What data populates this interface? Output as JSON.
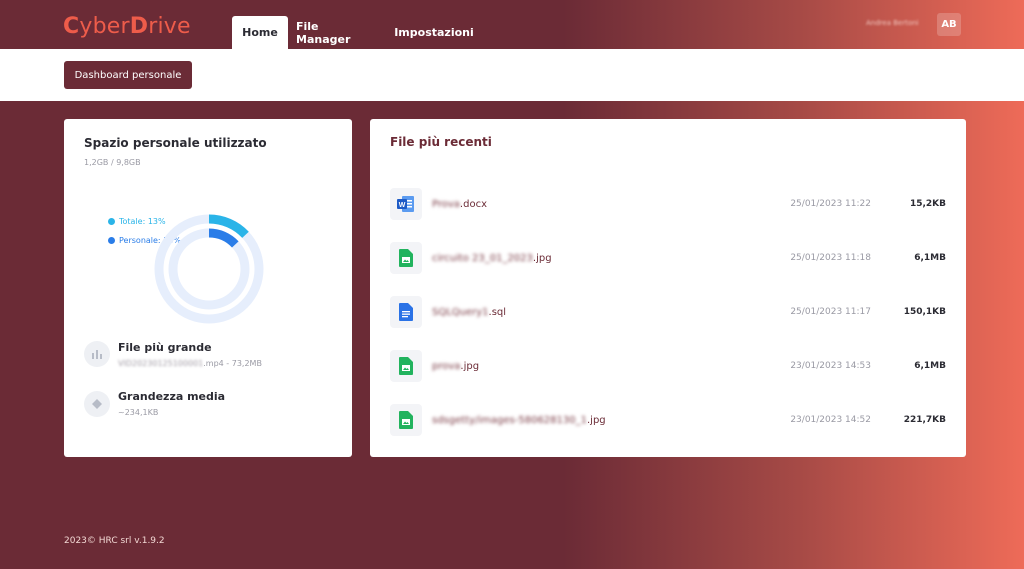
{
  "app": {
    "logo_c": "C",
    "logo_yber": "yber",
    "logo_d": "D",
    "logo_rive": "rive"
  },
  "nav": {
    "tabs": [
      {
        "label": "Home",
        "active": true
      },
      {
        "label": "File Manager",
        "active": false
      },
      {
        "label": "Impostazioni",
        "active": false
      }
    ],
    "user_name": "Andrea Bertoni",
    "avatar_initials": "AB"
  },
  "subbar": {
    "dashboard_button": "Dashboard personale"
  },
  "storage": {
    "title": "Spazio personale utilizzato",
    "amount": "1,2GB / 9,8GB",
    "legend_total": "Totale: 13%",
    "legend_personal": "Personale: 13%",
    "total_percent": 13,
    "personal_percent": 13,
    "colors": {
      "total": "#2ab4e8",
      "personal": "#2a7de8",
      "track": "#e6eefc"
    },
    "largest_file": {
      "title": "File più grande",
      "name_blurred": "VID20230125100001",
      "detail": ".mp4 - 73,2MB"
    },
    "average_size": {
      "title": "Grandezza media",
      "value": "~234,1KB"
    }
  },
  "recent": {
    "title": "File più recenti",
    "files": [
      {
        "icon": "word-doc-icon",
        "name_blurred": "Prova",
        "ext": ".docx",
        "date": "25/01/2023 11:22",
        "size": "15,2KB"
      },
      {
        "icon": "image-file-icon",
        "name_blurred": "circuito 23_01_2023",
        "ext": ".jpg",
        "date": "25/01/2023 11:18",
        "size": "6,1MB"
      },
      {
        "icon": "document-file-icon",
        "name_blurred": "SQLQuery1",
        "ext": ".sql",
        "date": "25/01/2023 11:17",
        "size": "150,1KB"
      },
      {
        "icon": "image-file-icon",
        "name_blurred": "prova",
        "ext": ".jpg",
        "date": "23/01/2023 14:53",
        "size": "6,1MB"
      },
      {
        "icon": "image-file-icon",
        "name_blurred": "sdsgetty/images-580628130_1",
        "ext": ".jpg",
        "date": "23/01/2023 14:52",
        "size": "221,7KB"
      }
    ]
  },
  "footer": {
    "text": "2023©  HRC srl v.1.9.2"
  }
}
